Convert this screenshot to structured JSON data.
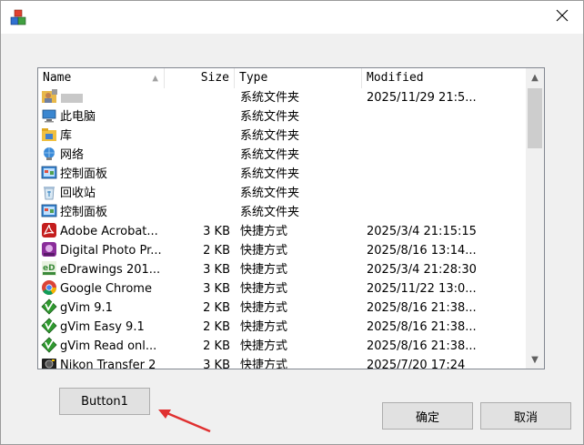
{
  "window": {
    "app_icon": "app-cubes-icon",
    "close_icon": "close-icon"
  },
  "list": {
    "columns": {
      "name": "Name",
      "size": "Size",
      "type": "Type",
      "modified": "Modified"
    },
    "sort": {
      "column": "name",
      "direction": "ascending"
    },
    "rows": [
      {
        "icon": "user-folder-icon",
        "name": "",
        "size": "",
        "type": "系统文件夹",
        "modified": "2025/11/29 21:5..."
      },
      {
        "icon": "computer-icon",
        "name": "此电脑",
        "size": "",
        "type": "系统文件夹",
        "modified": ""
      },
      {
        "icon": "library-icon",
        "name": "库",
        "size": "",
        "type": "系统文件夹",
        "modified": ""
      },
      {
        "icon": "network-icon",
        "name": "网络",
        "size": "",
        "type": "系统文件夹",
        "modified": ""
      },
      {
        "icon": "control-panel-icon",
        "name": "控制面板",
        "size": "",
        "type": "系统文件夹",
        "modified": ""
      },
      {
        "icon": "recycle-bin-icon",
        "name": "回收站",
        "size": "",
        "type": "系统文件夹",
        "modified": ""
      },
      {
        "icon": "control-panel-icon",
        "name": "控制面板",
        "size": "",
        "type": "系统文件夹",
        "modified": ""
      },
      {
        "icon": "adobe-acrobat-icon",
        "name": "Adobe Acrobat...",
        "size": "3 KB",
        "type": "快捷方式",
        "modified": "2025/3/4 21:15:15"
      },
      {
        "icon": "digital-photo-icon",
        "name": "Digital Photo Pr...",
        "size": "2 KB",
        "type": "快捷方式",
        "modified": "2025/8/16 13:14..."
      },
      {
        "icon": "edrawings-icon",
        "name": "eDrawings 201...",
        "size": "3 KB",
        "type": "快捷方式",
        "modified": "2025/3/4 21:28:30"
      },
      {
        "icon": "google-chrome-icon",
        "name": "Google Chrome",
        "size": "3 KB",
        "type": "快捷方式",
        "modified": "2025/11/22 13:0..."
      },
      {
        "icon": "gvim-icon",
        "name": "gVim 9.1",
        "size": "2 KB",
        "type": "快捷方式",
        "modified": "2025/8/16 21:38..."
      },
      {
        "icon": "gvim-icon",
        "name": "gVim Easy 9.1",
        "size": "2 KB",
        "type": "快捷方式",
        "modified": "2025/8/16 21:38..."
      },
      {
        "icon": "gvim-icon",
        "name": "gVim Read onl...",
        "size": "2 KB",
        "type": "快捷方式",
        "modified": "2025/8/16 21:38..."
      },
      {
        "icon": "nikon-transfer-icon",
        "name": "Nikon Transfer 2",
        "size": "3 KB",
        "type": "快捷方式",
        "modified": "2025/7/20 17:24"
      }
    ]
  },
  "buttons": {
    "button1": "Button1",
    "ok": "确定",
    "cancel": "取消"
  },
  "colors": {
    "annotation_arrow": "#e03030",
    "window_bg": "#f0f0f0",
    "button_bg": "#e1e1e1"
  }
}
